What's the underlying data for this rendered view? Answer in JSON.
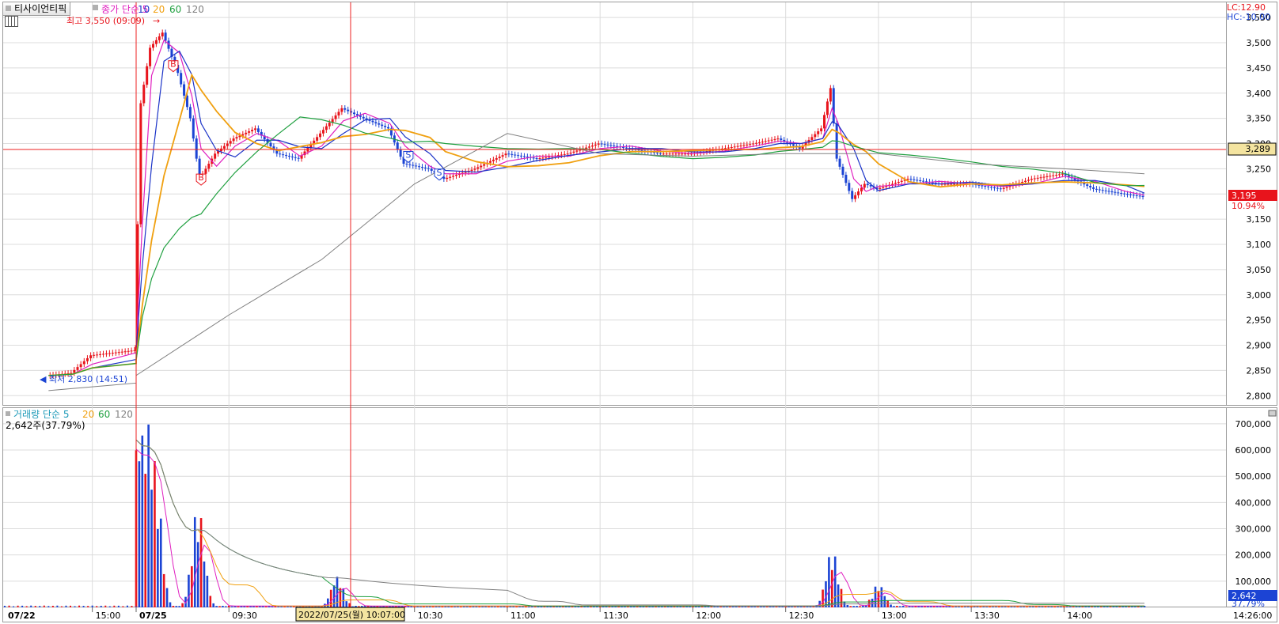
{
  "window": {
    "tab_label": "티사이언티픽",
    "table_icon": "table-icon",
    "chart_icon": "chart-toggle-icon"
  },
  "price_panel": {
    "legend_main": "종가 단순 5",
    "ma_periods": [
      "10",
      "20",
      "60",
      "120"
    ],
    "lc_label": "LC:12.90",
    "hc_label": "HC:-10.00",
    "high_annotation": "최고 3,550 (09:09)",
    "low_annotation": "최저 2,830 (14:51)",
    "crosshair_price": "3,289",
    "last_price": "3,195",
    "last_change": "10.94%",
    "signal_buy": "B",
    "signal_sell": "S"
  },
  "volume_panel": {
    "legend_main": "거래량 단순 5",
    "ma_periods": [
      "20",
      "60",
      "120"
    ],
    "last_volume_text": "2,642주(37.79%)",
    "last_volume": "2,642",
    "last_ratio": "37.79%"
  },
  "x_axis": {
    "labels": [
      "07/22",
      "15:00",
      "07/25",
      "09:30",
      "10:30",
      "11:00",
      "11:30",
      "12:00",
      "12:30",
      "13:00",
      "13:30",
      "14:00",
      "14:26:00"
    ],
    "crosshair_time": "2022/07/25(월) 10:07:00"
  },
  "colors": {
    "up": "#e8141c",
    "down": "#1c44d4",
    "ma5": "#e020c0",
    "ma10": "#1c34c8",
    "ma20": "#f0a010",
    "ma60": "#20a040",
    "ma120": "#808080",
    "crosshair": "#ee2222",
    "grid": "#dcdcdc"
  },
  "chart_data": [
    {
      "type": "candlestick",
      "title": "종가 단순 5 10 20 60 120",
      "ylim": [
        2780,
        3580
      ],
      "y_ticks": [
        2800,
        2850,
        2900,
        2950,
        3000,
        3050,
        3100,
        3150,
        3200,
        3250,
        3300,
        3350,
        3400,
        3450,
        3500,
        3550
      ],
      "y_tick_labels": [
        "2,800",
        "2,850",
        "2,900",
        "2,950",
        "3,000",
        "3,050",
        "3,100",
        "3,150",
        "3,200",
        "3,250",
        "3,300",
        "3,350",
        "3,400",
        "3,450",
        "3,500",
        "3,550"
      ],
      "series_close": [
        {
          "x": "07/22 14:40",
          "y": 2840
        },
        {
          "x": "07/22 14:51",
          "y": 2845
        },
        {
          "x": "07/22 15:00",
          "y": 2880
        },
        {
          "x": "07/22 15:20",
          "y": 2890
        },
        {
          "x": "07/25 09:00",
          "y": 2900
        },
        {
          "x": "07/25 09:02",
          "y": 3380
        },
        {
          "x": "07/25 09:05",
          "y": 3490
        },
        {
          "x": "07/25 09:09",
          "y": 3520
        },
        {
          "x": "07/25 09:14",
          "y": 3440
        },
        {
          "x": "07/25 09:18",
          "y": 3350
        },
        {
          "x": "07/25 09:21",
          "y": 3230
        },
        {
          "x": "07/25 09:26",
          "y": 3280
        },
        {
          "x": "07/25 09:32",
          "y": 3310
        },
        {
          "x": "07/25 09:39",
          "y": 3330
        },
        {
          "x": "07/25 09:46",
          "y": 3280
        },
        {
          "x": "07/25 09:53",
          "y": 3270
        },
        {
          "x": "07/25 10:00",
          "y": 3320
        },
        {
          "x": "07/25 10:07",
          "y": 3370
        },
        {
          "x": "07/25 10:14",
          "y": 3350
        },
        {
          "x": "07/25 10:22",
          "y": 3330
        },
        {
          "x": "07/25 10:27",
          "y": 3260
        },
        {
          "x": "07/25 10:35",
          "y": 3250
        },
        {
          "x": "07/25 10:40",
          "y": 3230
        },
        {
          "x": "07/25 10:50",
          "y": 3250
        },
        {
          "x": "07/25 11:00",
          "y": 3280
        },
        {
          "x": "07/25 11:10",
          "y": 3270
        },
        {
          "x": "07/25 11:20",
          "y": 3280
        },
        {
          "x": "07/25 11:30",
          "y": 3300
        },
        {
          "x": "07/25 11:40",
          "y": 3290
        },
        {
          "x": "07/25 11:50",
          "y": 3280
        },
        {
          "x": "07/25 12:00",
          "y": 3280
        },
        {
          "x": "07/25 12:10",
          "y": 3290
        },
        {
          "x": "07/25 12:20",
          "y": 3300
        },
        {
          "x": "07/25 12:28",
          "y": 3310
        },
        {
          "x": "07/25 12:35",
          "y": 3290
        },
        {
          "x": "07/25 12:42",
          "y": 3330
        },
        {
          "x": "07/25 12:45",
          "y": 3410
        },
        {
          "x": "07/25 12:47",
          "y": 3270
        },
        {
          "x": "07/25 12:52",
          "y": 3190
        },
        {
          "x": "07/25 12:56",
          "y": 3220
        },
        {
          "x": "07/25 13:00",
          "y": 3210
        },
        {
          "x": "07/25 13:10",
          "y": 3230
        },
        {
          "x": "07/25 13:20",
          "y": 3220
        },
        {
          "x": "07/25 13:30",
          "y": 3220
        },
        {
          "x": "07/25 13:40",
          "y": 3210
        },
        {
          "x": "07/25 13:50",
          "y": 3230
        },
        {
          "x": "07/25 14:00",
          "y": 3240
        },
        {
          "x": "07/25 14:10",
          "y": 3210
        },
        {
          "x": "07/25 14:20",
          "y": 3200
        },
        {
          "x": "07/25 14:26",
          "y": 3195
        }
      ],
      "series_ma120": [
        {
          "x": "07/22 14:40",
          "y": 2810
        },
        {
          "x": "07/22 15:20",
          "y": 2825
        },
        {
          "x": "07/25 09:00",
          "y": 2840
        },
        {
          "x": "07/25 09:30",
          "y": 2960
        },
        {
          "x": "07/25 10:00",
          "y": 3070
        },
        {
          "x": "07/25 10:30",
          "y": 3220
        },
        {
          "x": "07/25 11:00",
          "y": 3320
        },
        {
          "x": "07/25 11:30",
          "y": 3280
        },
        {
          "x": "07/25 12:00",
          "y": 3275
        },
        {
          "x": "07/25 12:30",
          "y": 3280
        },
        {
          "x": "07/25 13:00",
          "y": 3280
        },
        {
          "x": "07/25 13:30",
          "y": 3260
        },
        {
          "x": "07/25 14:00",
          "y": 3250
        },
        {
          "x": "07/25 14:26",
          "y": 3240
        }
      ]
    },
    {
      "type": "bar",
      "title": "거래량 단순 5 20 60 120",
      "ylim": [
        0,
        760000
      ],
      "y_ticks": [
        100000,
        200000,
        300000,
        400000,
        500000,
        600000,
        700000
      ],
      "y_tick_labels": [
        "100,000",
        "200,000",
        "300,000",
        "400,000",
        "500,000",
        "600,000",
        "700,000"
      ],
      "volume_peaks": [
        {
          "x": "07/25 09:00",
          "y": 710000
        },
        {
          "x": "07/25 09:02",
          "y": 715000
        },
        {
          "x": "07/25 09:04",
          "y": 720000
        },
        {
          "x": "07/25 09:06",
          "y": 560000
        },
        {
          "x": "07/25 09:20",
          "y": 390000
        },
        {
          "x": "07/25 10:05",
          "y": 120000
        },
        {
          "x": "07/25 12:45",
          "y": 220000
        },
        {
          "x": "07/25 13:00",
          "y": 90000
        },
        {
          "x": "07/25 14:26",
          "y": 2642
        }
      ]
    }
  ]
}
